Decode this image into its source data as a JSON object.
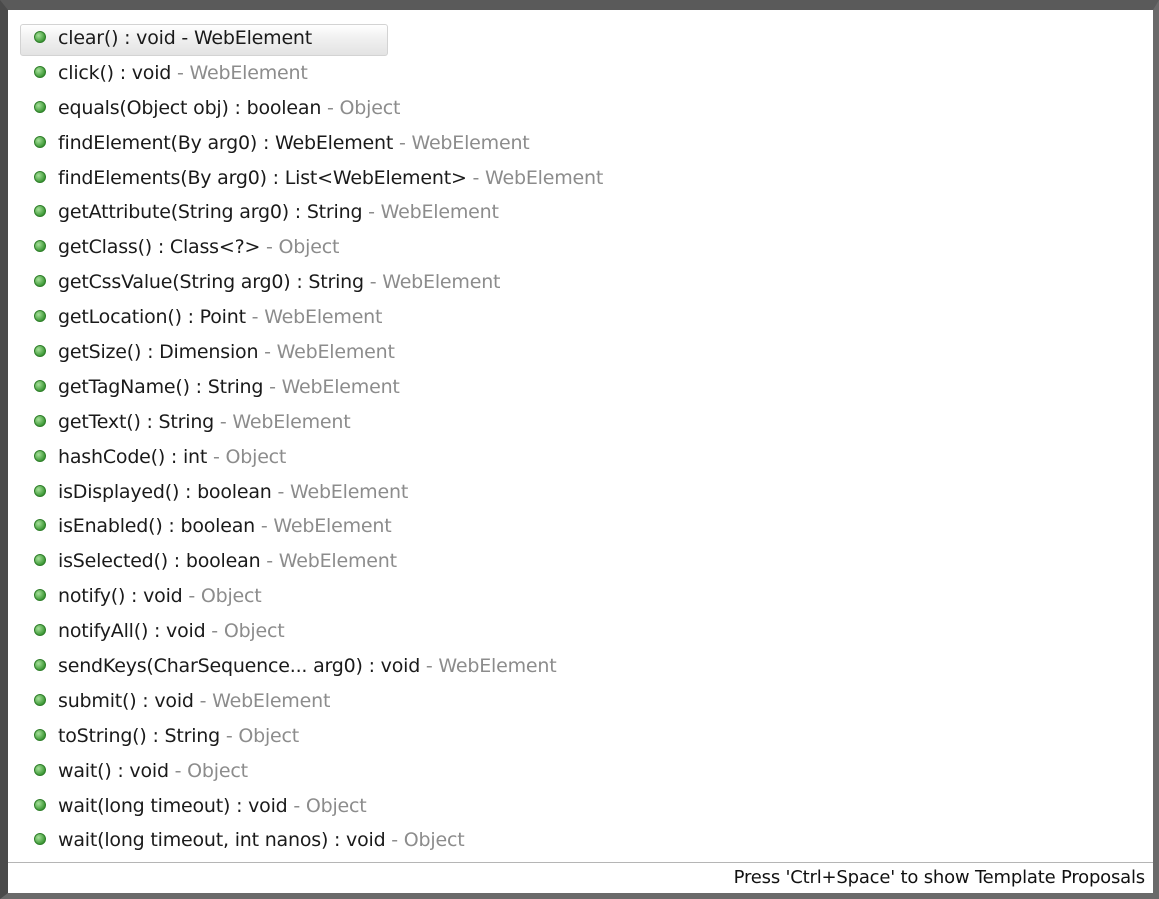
{
  "proposals": [
    {
      "signature": "clear() : void",
      "separator": " - ",
      "owner": "WebElement",
      "selected": true
    },
    {
      "signature": "click() : void",
      "separator": " - ",
      "owner": "WebElement"
    },
    {
      "signature": "equals(Object obj) : boolean",
      "separator": " - ",
      "owner": "Object"
    },
    {
      "signature": "findElement(By arg0) : WebElement",
      "separator": " - ",
      "owner": "WebElement"
    },
    {
      "signature": "findElements(By arg0) : List<WebElement>",
      "separator": " - ",
      "owner": "WebElement"
    },
    {
      "signature": "getAttribute(String arg0) : String",
      "separator": " - ",
      "owner": "WebElement"
    },
    {
      "signature": "getClass() : Class<?>",
      "separator": " - ",
      "owner": "Object"
    },
    {
      "signature": "getCssValue(String arg0) : String",
      "separator": " - ",
      "owner": "WebElement"
    },
    {
      "signature": "getLocation() : Point",
      "separator": " - ",
      "owner": "WebElement"
    },
    {
      "signature": "getSize() : Dimension",
      "separator": " - ",
      "owner": "WebElement"
    },
    {
      "signature": "getTagName() : String",
      "separator": " - ",
      "owner": "WebElement"
    },
    {
      "signature": "getText() : String",
      "separator": " - ",
      "owner": "WebElement"
    },
    {
      "signature": "hashCode() : int",
      "separator": " - ",
      "owner": "Object"
    },
    {
      "signature": "isDisplayed() : boolean",
      "separator": " - ",
      "owner": "WebElement"
    },
    {
      "signature": "isEnabled() : boolean",
      "separator": " - ",
      "owner": "WebElement"
    },
    {
      "signature": "isSelected() : boolean",
      "separator": " - ",
      "owner": "WebElement"
    },
    {
      "signature": "notify() : void",
      "separator": " - ",
      "owner": "Object"
    },
    {
      "signature": "notifyAll() : void",
      "separator": " - ",
      "owner": "Object"
    },
    {
      "signature": "sendKeys(CharSequence... arg0) : void",
      "separator": " - ",
      "owner": "WebElement"
    },
    {
      "signature": "submit() : void",
      "separator": " - ",
      "owner": "WebElement"
    },
    {
      "signature": "toString() : String",
      "separator": " - ",
      "owner": "Object"
    },
    {
      "signature": "wait() : void",
      "separator": " - ",
      "owner": "Object"
    },
    {
      "signature": "wait(long timeout) : void",
      "separator": " - ",
      "owner": "Object"
    },
    {
      "signature": "wait(long timeout, int nanos) : void",
      "separator": " - ",
      "owner": "Object"
    }
  ],
  "status_bar": {
    "hint": "Press 'Ctrl+Space' to show Template Proposals"
  },
  "icons": {
    "method": "public-method-icon"
  },
  "colors": {
    "method_dot": "#3f9a38",
    "owner_text": "#8c8c8c",
    "signature_text": "#1a1a1a"
  }
}
